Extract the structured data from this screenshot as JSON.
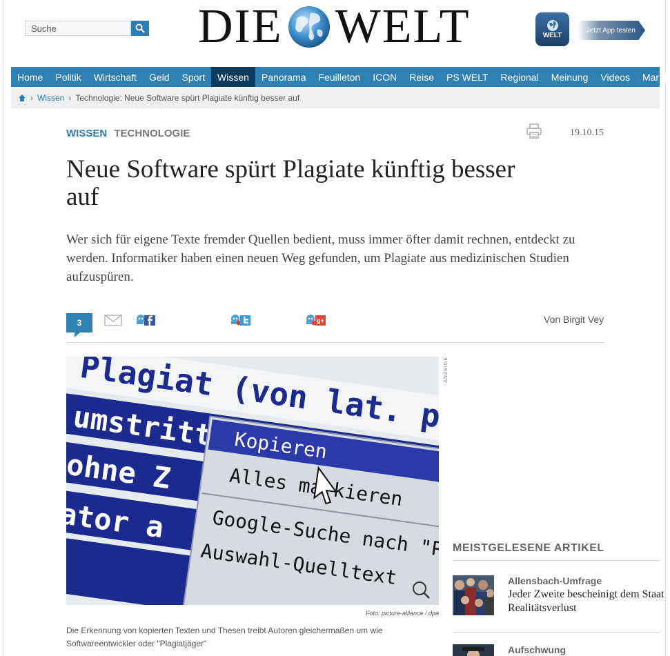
{
  "header": {
    "search_placeholder": "Suche",
    "logo_left": "DIE",
    "logo_right": "WELT",
    "app_icon_label": "WELT",
    "app_banner_label": "Jetzt App testen"
  },
  "nav": {
    "items": [
      "Home",
      "Politik",
      "Wirtschaft",
      "Geld",
      "Sport",
      "Wissen",
      "Panorama",
      "Feuilleton",
      "ICON",
      "Reise",
      "PS WELT",
      "Regional",
      "Meinung",
      "Videos",
      "Markt"
    ],
    "active": "Wissen"
  },
  "breadcrumb": {
    "sep": "›",
    "section": "Wissen",
    "current": "Technologie: Neue Software spürt Plagiate künftig besser auf"
  },
  "article": {
    "section": "WISSEN",
    "subsection": "TECHNOLOGIE",
    "date": "19.10.15",
    "headline": "Neue Software spürt Plagiate künftig besser auf",
    "lead": "Wer sich für eigene Texte fremder Quellen bedient, muss immer öfter damit rechnen, entdeckt zu werden. Informatiker haben einen neuen Weg gefunden, um Plagiate aus medizinischen Studien aufzuspüren.",
    "comment_count": "3",
    "author": "Von Birgit Vey",
    "photo_credit": "Foto: picture-alliance / dpa",
    "caption": "Die Erkennung von kopierten Texten und Thesen treibt Autoren gleichermaßen um wie Softwareentwickler oder \"Plagiatjäger\"",
    "ad_label": "ANZEIGE"
  },
  "image_text": {
    "line1": "Plagiat (von lat. plagiu",
    "line2": "umstritte",
    "line3": "ohne Z",
    "line4": "ator a",
    "menu1": "Kopieren",
    "menu2": "Alles markieren",
    "menu3": "Google-Suche nach \"Plagi",
    "menu4": "Auswahl-Quelltext"
  },
  "sidebar": {
    "most_read_title": "MEISTGELESENE ARTIKEL",
    "items": [
      {
        "kicker": "Allensbach-Umfrage",
        "title": "Jeder Zweite bescheinigt dem Staat Realitätsverlust"
      },
      {
        "kicker": "Aufschwung",
        "title": ""
      }
    ]
  },
  "colors": {
    "brand_blue": "#2d81b5",
    "nav_active": "#0b3b5d"
  }
}
